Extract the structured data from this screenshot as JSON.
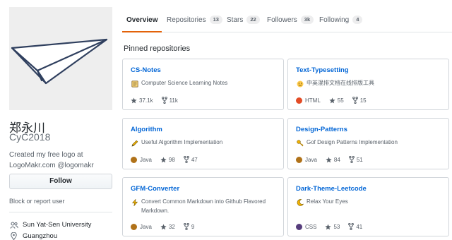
{
  "profile": {
    "fullname": "郑永川",
    "username": "CyC2018",
    "bio": "Created my free logo at LogoMakr.com @logomakr",
    "follow_label": "Follow",
    "report_label": "Block or report user",
    "organization": "Sun Yat-Sen University",
    "location": "Guangzhou",
    "avatar_icon": "paper-plane-icon"
  },
  "tabs": [
    {
      "label": "Overview",
      "count": ""
    },
    {
      "label": "Repositories",
      "count": "13"
    },
    {
      "label": "Stars",
      "count": "22"
    },
    {
      "label": "Followers",
      "count": "3k"
    },
    {
      "label": "Following",
      "count": "4"
    }
  ],
  "pinned": {
    "title": "Pinned repositories",
    "repos": [
      {
        "name": "CS-Notes",
        "emoji": "book-icon",
        "description": "Computer Science Learning Notes",
        "language": "",
        "lang_color": "",
        "stars": "37.1k",
        "forks": "11k"
      },
      {
        "name": "Text-Typesetting",
        "emoji": "smile-icon",
        "description": "中英混排文档在线排版工具",
        "language": "HTML",
        "lang_color": "#e34c26",
        "stars": "55",
        "forks": "15"
      },
      {
        "name": "Algorithm",
        "emoji": "pencil-icon",
        "description": "Useful Algorithm Implementation",
        "language": "Java",
        "lang_color": "#b07219",
        "stars": "98",
        "forks": "47"
      },
      {
        "name": "Design-Patterns",
        "emoji": "key-icon",
        "description": "Gof Design Patterns Implementation",
        "language": "Java",
        "lang_color": "#b07219",
        "stars": "84",
        "forks": "51"
      },
      {
        "name": "GFM-Converter",
        "emoji": "zap-icon",
        "description": "Convert Common Markdown into Github Flavored Markdown.",
        "language": "Java",
        "lang_color": "#b07219",
        "stars": "32",
        "forks": "9"
      },
      {
        "name": "Dark-Theme-Leetcode",
        "emoji": "moon-icon",
        "description": "Relax Your Eyes",
        "language": "CSS",
        "lang_color": "#563d7c",
        "stars": "53",
        "forks": "41"
      }
    ]
  }
}
